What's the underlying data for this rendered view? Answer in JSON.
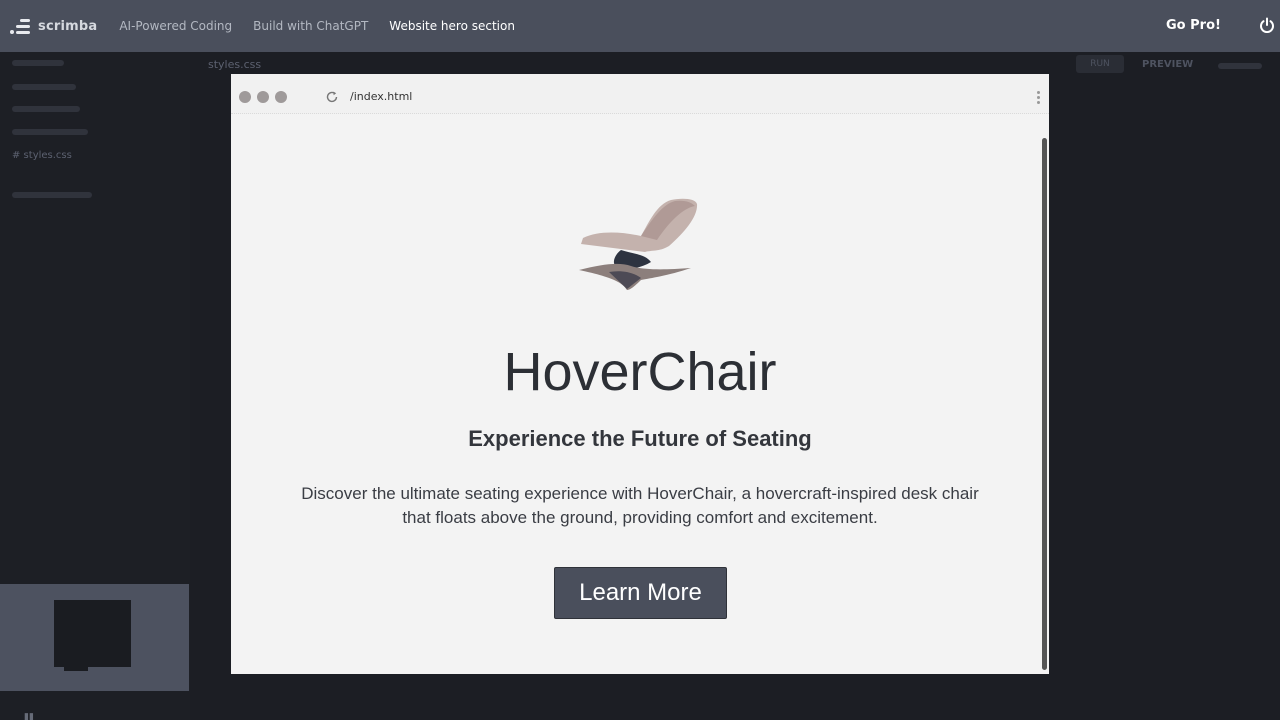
{
  "topbar": {
    "logo_text": "scrimba",
    "breadcrumbs": [
      "AI-Powered Coding",
      "Build with ChatGPT",
      "Website hero section"
    ],
    "go_pro_label": "Go Pro!",
    "power_icon": "power-icon"
  },
  "editor": {
    "file_label": "# styles.css",
    "tab_label": "styles.css",
    "run_label": "RUN",
    "preview_label": "PREVIEW"
  },
  "preview": {
    "url": "/index.html",
    "hero": {
      "title": "HoverChair",
      "subtitle": "Experience the Future of Seating",
      "description": "Discover the ultimate seating experience with HoverChair, a hovercraft-inspired desk chair that floats above the ground, providing comfort and excitement.",
      "cta_label": "Learn More"
    }
  },
  "colors": {
    "topbar_bg": "#4a4f5c",
    "background": "#1c1e24",
    "preview_bg": "#f3f3f3",
    "cta_bg": "#4a4f5c"
  }
}
